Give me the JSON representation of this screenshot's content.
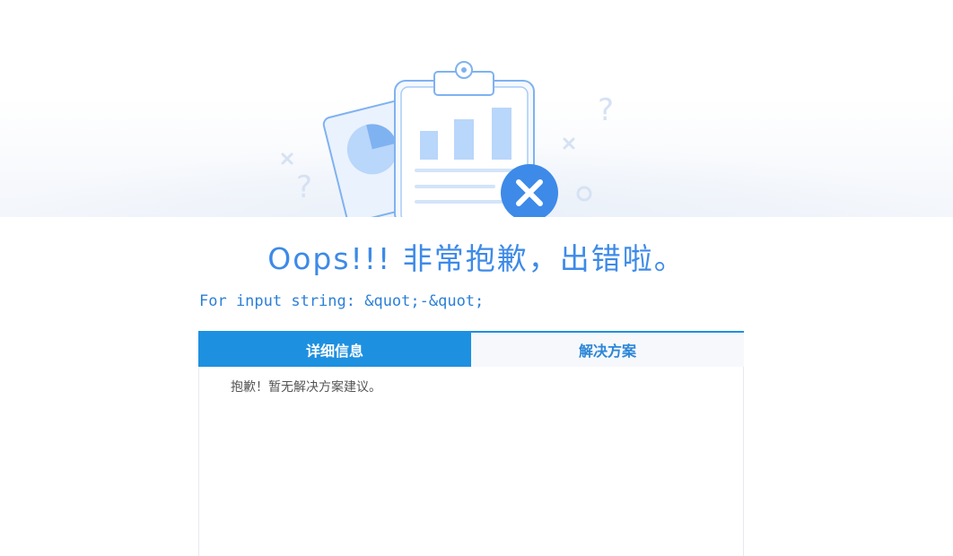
{
  "headline": "Oops!!! 非常抱歉，出错啦。",
  "error_message": "For input string: &quot;-&quot;",
  "tabs": [
    {
      "label": "详细信息",
      "active": true
    },
    {
      "label": "解决方案",
      "active": false
    }
  ],
  "panel": {
    "text": "抱歉！暂无解决方案建议。"
  },
  "colors": {
    "accent": "#1e90e0",
    "headline": "#3d8ae8",
    "error_text": "#2c7fd6"
  }
}
